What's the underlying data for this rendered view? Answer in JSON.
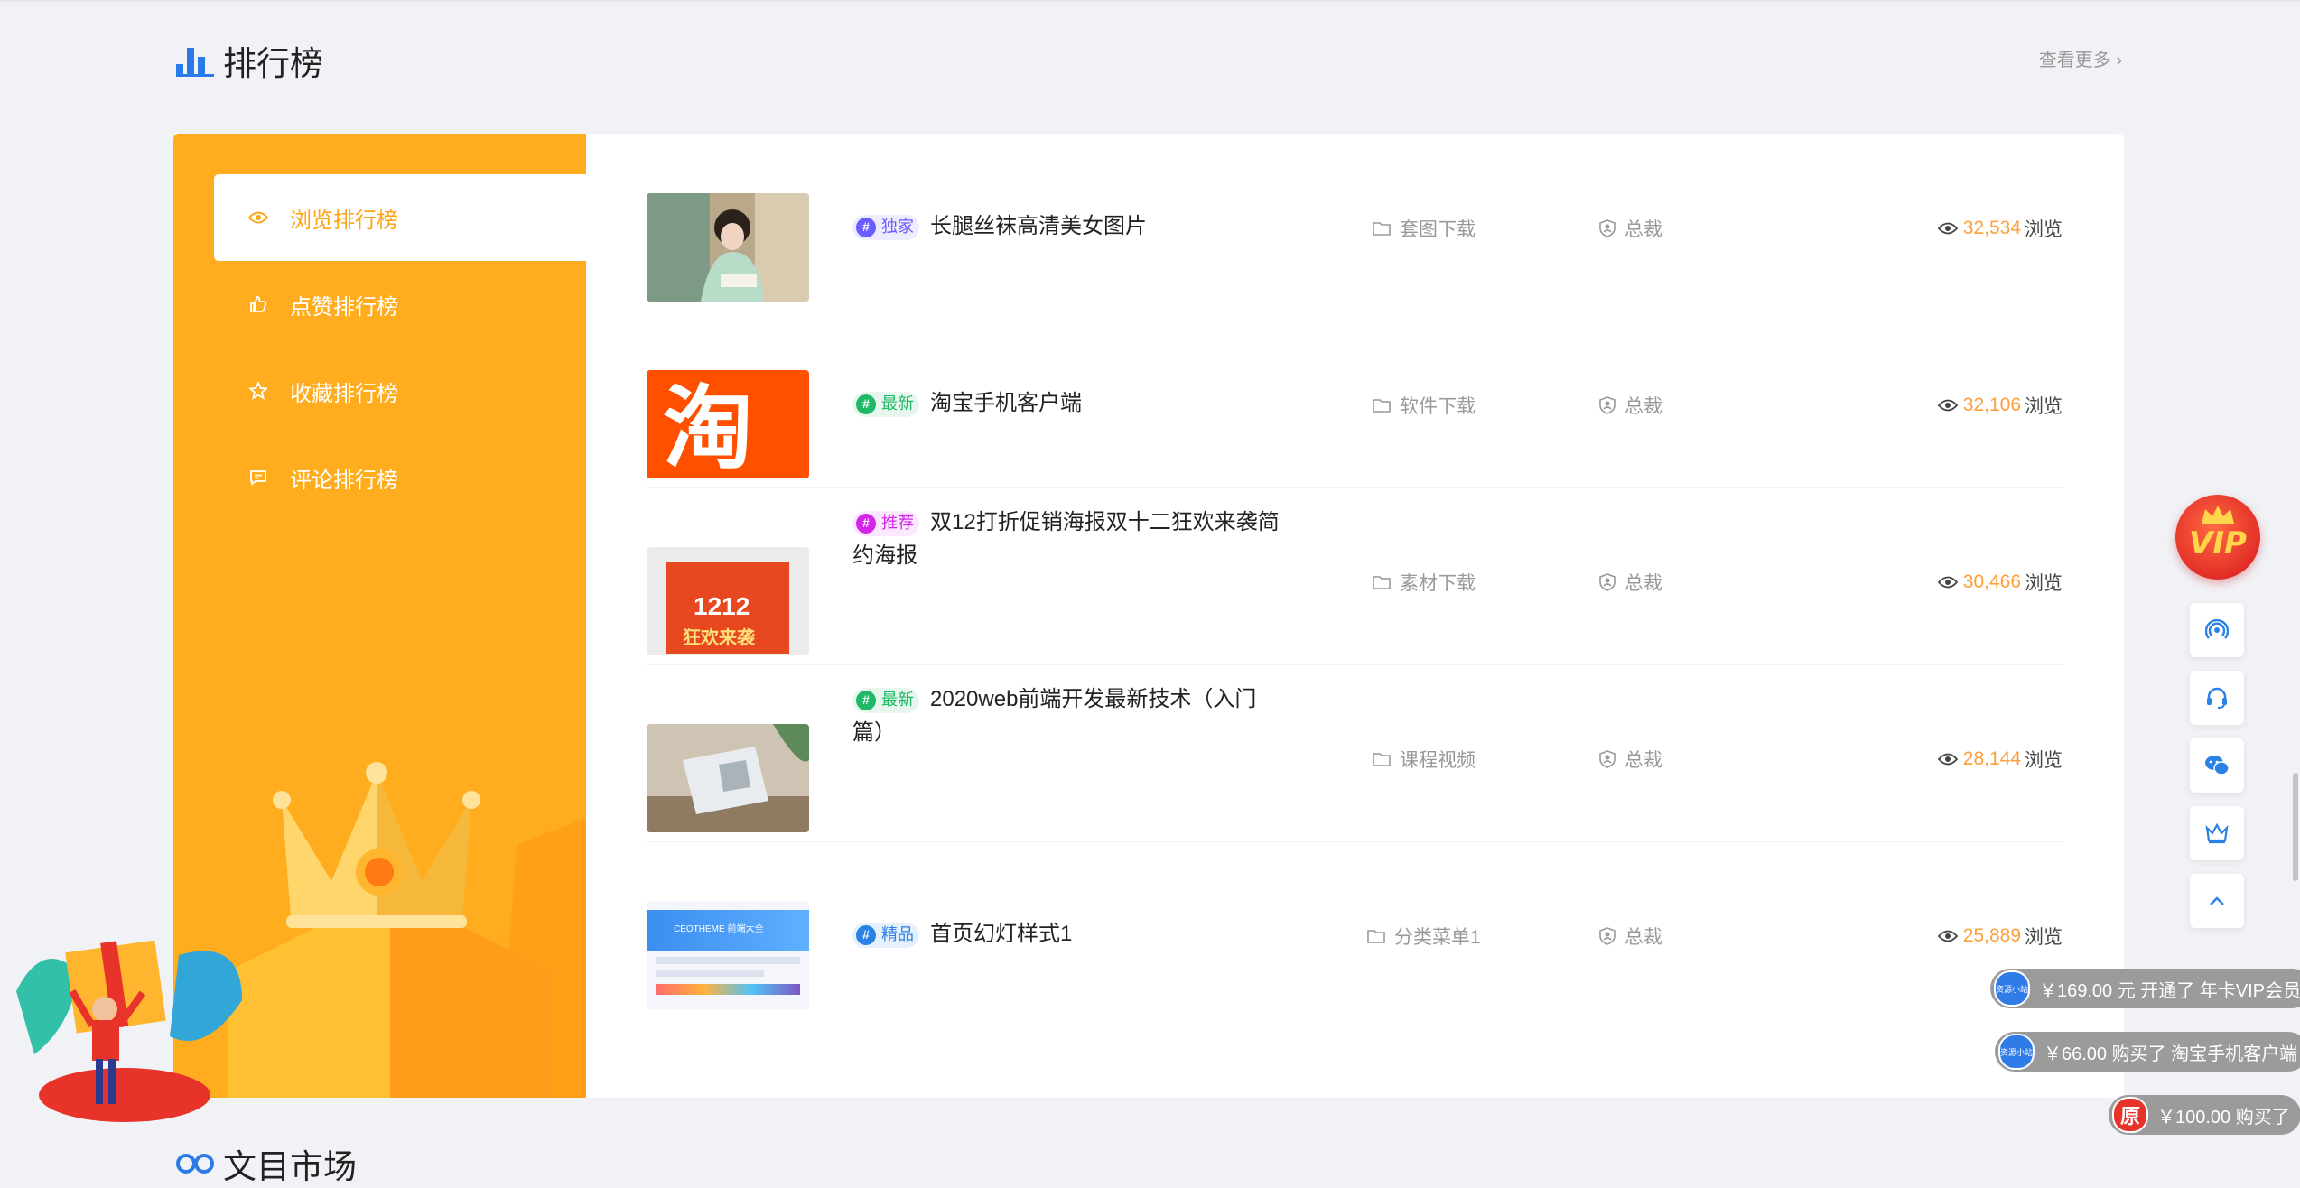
{
  "colors": {
    "accent": "#ffad1f",
    "view_count": "#ff9f3a"
  },
  "section": {
    "title": "排行榜",
    "more": "查看更多 ›"
  },
  "sidebar": {
    "items": [
      {
        "label": "浏览排行榜",
        "icon": "eye-icon",
        "active": true
      },
      {
        "label": "点赞排行榜",
        "icon": "thumbs-up-icon",
        "active": false
      },
      {
        "label": "收藏排行榜",
        "icon": "star-icon",
        "active": false
      },
      {
        "label": "评论排行榜",
        "icon": "comment-icon",
        "active": false
      }
    ]
  },
  "rows": [
    {
      "tag": "独家",
      "tag_color": "#6b5cff",
      "title": "长腿丝袜高清美女图片",
      "category": "套图下载",
      "author": "总裁",
      "views": "32,534",
      "views_label": "浏览"
    },
    {
      "tag": "最新",
      "tag_color": "#1fb866",
      "title": "淘宝手机客户端",
      "category": "软件下载",
      "author": "总裁",
      "views": "32,106",
      "views_label": "浏览"
    },
    {
      "tag": "推荐",
      "tag_color": "#d425e8",
      "title": "双12打折促销海报双十二狂欢来袭简约海报",
      "category": "素材下载",
      "author": "总裁",
      "views": "30,466",
      "views_label": "浏览"
    },
    {
      "tag": "最新",
      "tag_color": "#1fb866",
      "title": "2020web前端开发最新技术（入门篇）",
      "category": "课程视频",
      "author": "总裁",
      "views": "28,144",
      "views_label": "浏览"
    },
    {
      "tag": "精品",
      "tag_color": "#2a82e4",
      "title": "首页幻灯样式1",
      "category": "分类菜单1",
      "author": "总裁",
      "views": "25,889",
      "views_label": "浏览"
    }
  ],
  "thumbs": {
    "taobao_text": "淘",
    "poster_line1": "1212",
    "poster_line2": "狂欢来袭",
    "site_banner": "CEOTHEME 前端大全"
  },
  "float": {
    "vip": "VIP",
    "buttons": [
      "signal-icon",
      "headset-icon",
      "wechat-icon",
      "crown-icon",
      "arrow-up-icon"
    ]
  },
  "notices": [
    {
      "avatar": "资源小站",
      "text": "￥169.00 元 开通了 年卡VIP会员"
    },
    {
      "avatar": "资源小站",
      "text": "￥66.00 购买了 淘宝手机客户端"
    },
    {
      "avatar": "原",
      "text": "￥100.00 购买了"
    }
  ],
  "next_section": {
    "title": "文目市场"
  }
}
